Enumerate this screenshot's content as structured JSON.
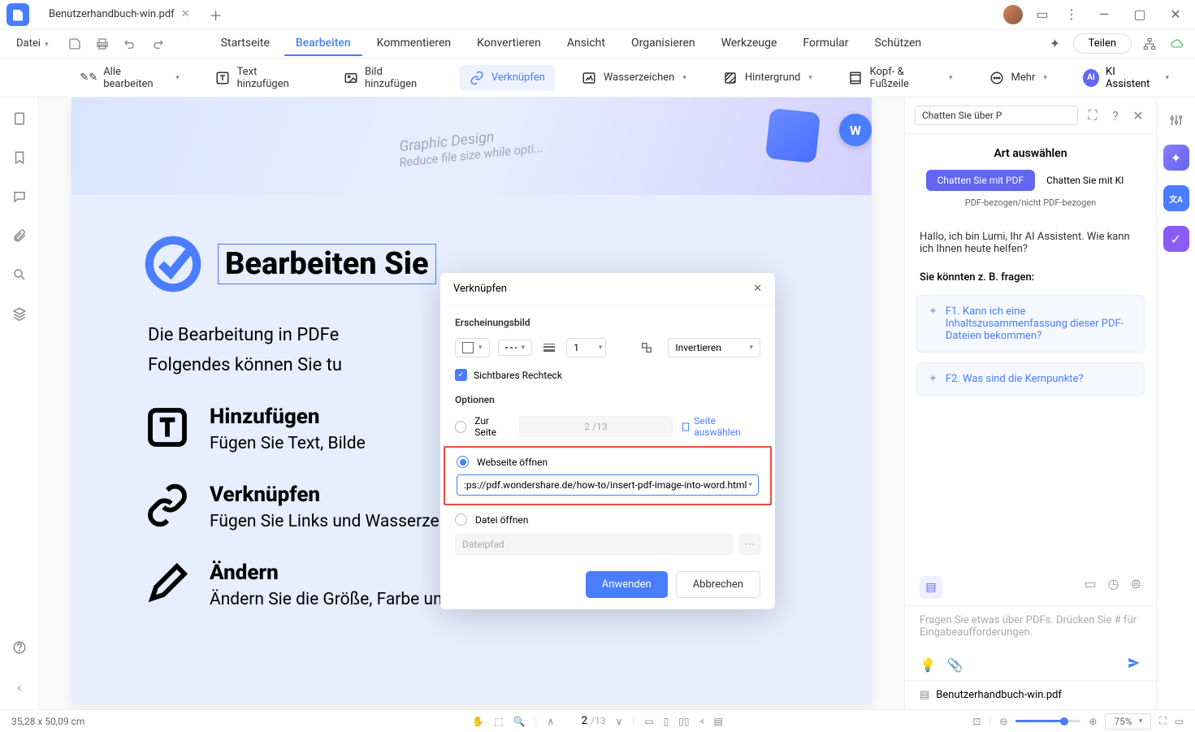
{
  "titlebar": {
    "tab_label": "Benutzerhandbuch-win.pdf"
  },
  "menu": {
    "file": "Datei",
    "items": [
      "Startseite",
      "Bearbeiten",
      "Kommentieren",
      "Konvertieren",
      "Ansicht",
      "Organisieren",
      "Werkzeuge",
      "Formular",
      "Schützen"
    ],
    "active_index": 1,
    "share": "Teilen"
  },
  "toolbar": {
    "edit_all": "Alle bearbeiten",
    "add_text": "Text hinzufügen",
    "add_image": "Bild hinzufügen",
    "link": "Verknüpfen",
    "watermark": "Wasserzeichen",
    "background": "Hintergrund",
    "header_footer": "Kopf- & Fußzeile",
    "more": "Mehr",
    "ai_assistant": "KI Assistent",
    "ai_badge": "AI"
  },
  "doc": {
    "banner_text_1": "Graphic Design",
    "banner_text_2": "Reduce file size while opti...",
    "title": "Bearbeiten Sie",
    "intro1": "Die Bearbeitung in PDFe",
    "intro2": "Folgendes können Sie tu",
    "feat1_title": "Hinzufügen",
    "feat1_desc": "Fügen Sie Text, Bilde",
    "feat2_title": "Verknüpfen",
    "feat2_desc": "Fügen Sie Links und Wasserzeichen zu Ihren PDF-Dateien hinzu.",
    "feat3_title": "Ändern",
    "feat3_desc": "Ändern Sie die Größe, Farbe und Schriftart von Text oder Links."
  },
  "dialog": {
    "title": "Verknüpfen",
    "section_appearance": "Erscheinungsbild",
    "thickness_value": "1",
    "invert": "Invertieren",
    "visible_rect": "Sichtbares Rechteck",
    "section_options": "Optionen",
    "opt_to_page": "Zur Seite",
    "page_value": "2 /13",
    "select_page": "Seite auswählen",
    "opt_website": "Webseite öffnen",
    "url_value": ":ps://pdf.wondershare.de/how-to/insert-pdf-image-into-word.html",
    "opt_file": "Datei öffnen",
    "file_placeholder": "Dateipfad",
    "apply": "Anwenden",
    "cancel": "Abbrechen"
  },
  "right_panel": {
    "search_value": "Chatten Sie über P",
    "section_title": "Art auswählen",
    "pill_chat_pdf": "Chatten Sie mit PDF",
    "pill_chat_ai": "Chatten Sie mit KI",
    "subline": "PDF-bezogen/nicht PDF-bezogen",
    "greeting": "Hallo, ich bin Lumi, Ihr AI Assistent. Wie kann ich Ihnen heute helfen?",
    "suggest_title": "Sie könnten z. B. fragen:",
    "suggest1": "F1. Kann ich eine Inhaltszusammenfassung dieser PDF-Dateien bekommen?",
    "suggest2": "F2. Was sind die Kernpunkte?",
    "input_placeholder": "Fragen Sie etwas über PDFs. Drücken Sie # für Eingabeaufforderungen.",
    "file_label": "Benutzerhandbuch-win.pdf"
  },
  "statusbar": {
    "cursor": "35,28 x 50,09 cm",
    "page_current": "2",
    "page_total": "/13",
    "zoom": "75%"
  }
}
